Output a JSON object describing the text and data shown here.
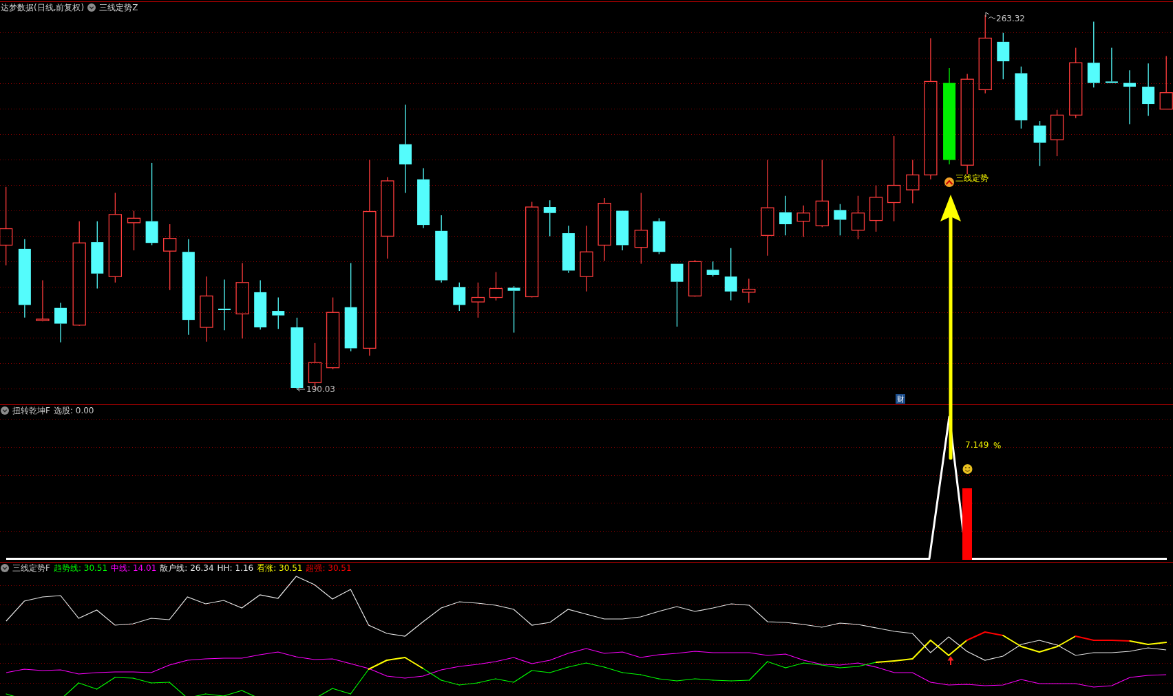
{
  "price_panel": {
    "title": "达梦数据(日线,前复权)",
    "indicator": "三线定势Z",
    "high_label": "263.32",
    "low_label": "190.03",
    "signal_label": "三线定势",
    "marker": "财"
  },
  "signal_panel": {
    "indicator": "扭转乾坤F",
    "readout": "选股: 0.00",
    "percent_value": "7.149",
    "percent_unit": "%"
  },
  "oscillator_panel": {
    "indicator": "三线定势F",
    "legend": [
      {
        "label": "趋势线: 30.51",
        "color": "#00ff00"
      },
      {
        "label": "中线: 14.01",
        "color": "#ff00ff"
      },
      {
        "label": "散户线: 26.34",
        "color": "#e6e6e6"
      },
      {
        "label": "HH: 1.16",
        "color": "#e6e6e6"
      },
      {
        "label": "看涨: 30.51",
        "color": "#ffff00"
      },
      {
        "label": "超强: 30.51",
        "color": "#ff0000"
      }
    ]
  }
}
